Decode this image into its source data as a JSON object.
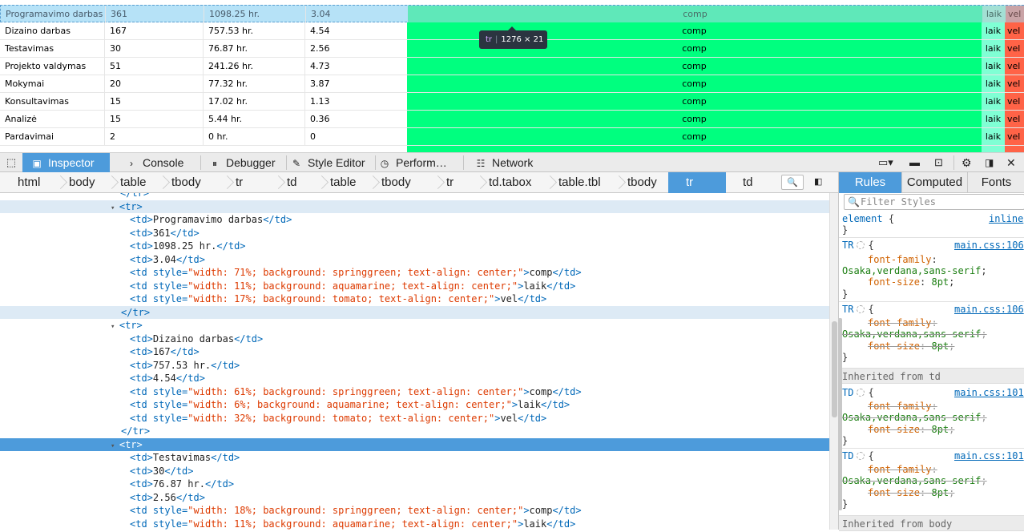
{
  "page_table": {
    "rows": [
      {
        "name": "Programavimo darbas",
        "count": "361",
        "hours": "1098.25 hr.",
        "ratio": "3.04",
        "comp": "comp",
        "laik": "laik",
        "vel": "vel",
        "highlighted": true
      },
      {
        "name": "Dizaino darbas",
        "count": "167",
        "hours": "757.53 hr.",
        "ratio": "4.54",
        "comp": "comp",
        "laik": "laik",
        "vel": "vel"
      },
      {
        "name": "Testavimas",
        "count": "30",
        "hours": "76.87 hr.",
        "ratio": "2.56",
        "comp": "comp",
        "laik": "laik",
        "vel": "vel"
      },
      {
        "name": "Projekto valdymas",
        "count": "51",
        "hours": "241.26 hr.",
        "ratio": "4.73",
        "comp": "comp",
        "laik": "laik",
        "vel": "vel"
      },
      {
        "name": "Mokymai",
        "count": "20",
        "hours": "77.32 hr.",
        "ratio": "3.87",
        "comp": "comp",
        "laik": "laik",
        "vel": "vel"
      },
      {
        "name": "Konsultavimas",
        "count": "15",
        "hours": "17.02 hr.",
        "ratio": "1.13",
        "comp": "comp",
        "laik": "laik",
        "vel": "vel"
      },
      {
        "name": "Analizė",
        "count": "15",
        "hours": "5.44 hr.",
        "ratio": "0.36",
        "comp": "comp",
        "laik": "laik",
        "vel": "vel"
      },
      {
        "name": "Pardavimai",
        "count": "2",
        "hours": "0 hr.",
        "ratio": "0",
        "comp": "comp",
        "laik": "laik",
        "vel": "vel"
      }
    ],
    "colors": {
      "comp": "#00ff7f",
      "laik": "#7fffd4",
      "vel": "#ff6347"
    }
  },
  "tooltip": {
    "tag": "tr",
    "size": "1276 × 21"
  },
  "toolbar": {
    "tabs": [
      {
        "label": "Inspector",
        "icon": "inspector-icon",
        "active": true
      },
      {
        "label": "Console",
        "icon": "console-icon"
      },
      {
        "label": "Debugger",
        "icon": "debugger-icon"
      },
      {
        "label": "Style Editor",
        "icon": "style-editor-icon"
      },
      {
        "label": "Perform…",
        "icon": "performance-icon"
      },
      {
        "label": "Network",
        "icon": "network-icon"
      }
    ]
  },
  "breadcrumbs": [
    "html",
    "body",
    "table",
    "tbody",
    "tr",
    "td",
    "table",
    "tbody",
    "tr",
    "td.tabox",
    "table.tbl",
    "tbody",
    "tr",
    "td"
  ],
  "breadcrumb_active_index": 12,
  "markup": {
    "lines": [
      {
        "kind": "tag",
        "text": "</tr>",
        "indent": "  ▸ ",
        "partial": true
      },
      {
        "kind": "open",
        "text": "<tr>",
        "indent": "  ▾ ",
        "bg": true
      },
      {
        "kind": "td",
        "text": "Programavimo darbas"
      },
      {
        "kind": "td",
        "text": "361"
      },
      {
        "kind": "td",
        "text": "1098.25 hr."
      },
      {
        "kind": "td",
        "text": "3.04"
      },
      {
        "kind": "tds",
        "style": "width: 71%; background: springgreen; text-align: center;",
        "text": "comp"
      },
      {
        "kind": "tds",
        "style": "width: 11%; background: aquamarine; text-align: center;",
        "text": "laik"
      },
      {
        "kind": "tds",
        "style": "width: 17%; background: tomato; text-align: center;",
        "text": "vel"
      },
      {
        "kind": "close",
        "text": "</tr>",
        "bg": true
      },
      {
        "kind": "open",
        "text": "<tr>",
        "indent": "  ▾ "
      },
      {
        "kind": "td",
        "text": "Dizaino darbas"
      },
      {
        "kind": "td",
        "text": "167"
      },
      {
        "kind": "td",
        "text": "757.53 hr."
      },
      {
        "kind": "td",
        "text": "4.54"
      },
      {
        "kind": "tds",
        "style": "width: 61%; background: springgreen; text-align: center;",
        "text": "comp"
      },
      {
        "kind": "tds",
        "style": "width: 6%; background: aquamarine; text-align: center;",
        "text": "laik"
      },
      {
        "kind": "tds",
        "style": "width: 32%; background: tomato; text-align: center;",
        "text": "vel"
      },
      {
        "kind": "close",
        "text": "</tr>"
      },
      {
        "kind": "open",
        "text": "<tr>",
        "indent": "  ▾ ",
        "selected": true
      },
      {
        "kind": "td",
        "text": "Testavimas"
      },
      {
        "kind": "td",
        "text": "30"
      },
      {
        "kind": "td",
        "text": "76.87 hr."
      },
      {
        "kind": "td",
        "text": "2.56"
      },
      {
        "kind": "tds",
        "style": "width: 18%; background: springgreen; text-align: center;",
        "text": "comp"
      },
      {
        "kind": "tds",
        "style": "width: 11%; background: aquamarine; text-align: center;",
        "text": "laik"
      }
    ]
  },
  "sidebar": {
    "tabs": [
      "Rules",
      "Computed",
      "Fonts"
    ],
    "active_tab": "Rules",
    "filter_placeholder": "Filter Styles",
    "rules": [
      {
        "selector": "element",
        "source": "inline",
        "open": "{",
        "close": "}"
      },
      {
        "selector": "TR",
        "source": "main.css:106",
        "props": [
          {
            "name": "font-family",
            "value": "Osaka,verdana,sans-serif"
          },
          {
            "name": "font-size",
            "value": "8pt"
          }
        ]
      },
      {
        "selector": "TR",
        "source": "main.css:106",
        "overridden": true,
        "props": [
          {
            "name": "font-family",
            "value": "Osaka,verdana,sans-serif"
          },
          {
            "name": "font-size",
            "value": "8pt"
          }
        ]
      }
    ],
    "inherited_td": "Inherited from td",
    "td_rules": [
      {
        "selector": "TD",
        "source": "main.css:101"
      },
      {
        "selector": "TD",
        "source": "main.css:101"
      }
    ],
    "inherited_body": "Inherited from body"
  }
}
